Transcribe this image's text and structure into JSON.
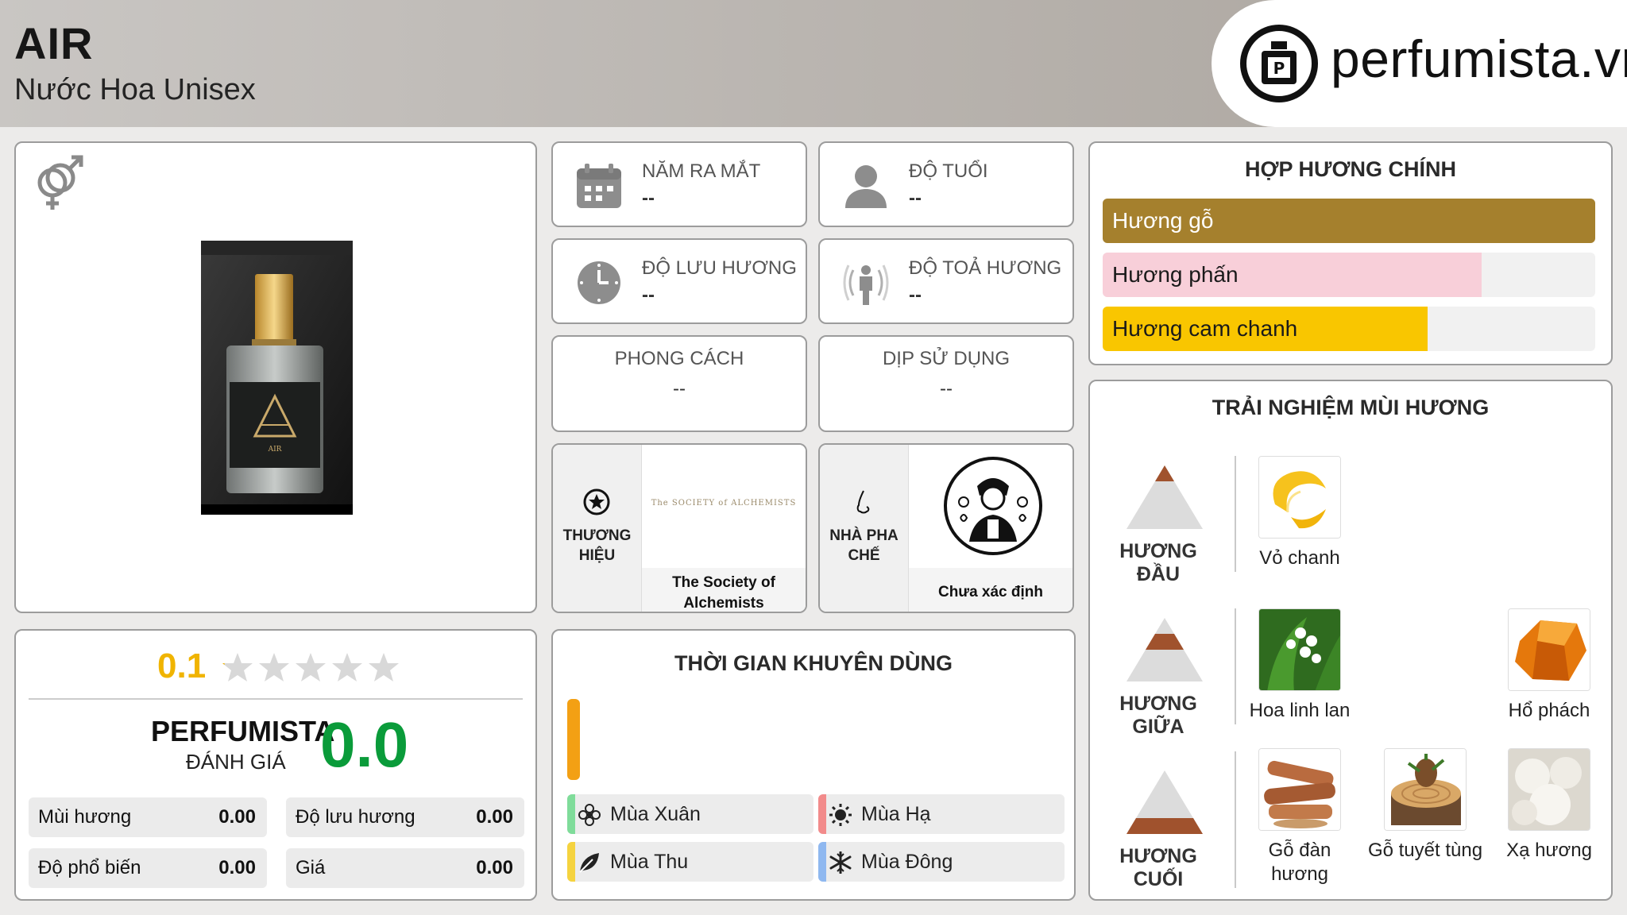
{
  "header": {
    "title": "AIR",
    "subtitle": "Nước Hoa Unisex",
    "logo_text": "perfumista.vn"
  },
  "product": {
    "gender_icon": "unisex-gender-icon",
    "bottle_label": "AIR"
  },
  "info": {
    "release_year": {
      "label": "NĂM RA MẮT",
      "value": "--",
      "icon": "calendar-icon"
    },
    "age": {
      "label": "ĐỘ TUỔI",
      "value": "--",
      "icon": "person-icon"
    },
    "longevity": {
      "label": "ĐỘ LƯU HƯƠNG",
      "value": "--",
      "icon": "clock-icon"
    },
    "sillage": {
      "label": "ĐỘ TOẢ HƯƠNG",
      "value": "--",
      "icon": "radiating-person-icon"
    },
    "style": {
      "label": "PHONG CÁCH",
      "value": "--"
    },
    "occasion": {
      "label": "DỊP SỬ DỤNG",
      "value": "--"
    }
  },
  "brand": {
    "label": "THƯƠNG HIỆU",
    "logo_text": "The SOCIETY of ALCHEMISTS",
    "name": "The Society of Alchemists",
    "icon": "star-badge-icon"
  },
  "perfumer": {
    "label": "NHÀ PHA CHẾ",
    "name": "Chưa xác định",
    "icon": "nose-icon"
  },
  "accords": {
    "title": "HỢP HƯƠNG CHÍNH",
    "items": [
      {
        "label": "Hương gỗ",
        "fraction": 1.0,
        "color": "#a5802d",
        "text_color": "#ffffff"
      },
      {
        "label": "Hương phấn",
        "fraction": 0.77,
        "color": "#f8cfd9",
        "text_color": "#1a1a1a"
      },
      {
        "label": "Hương cam chanh",
        "fraction": 0.66,
        "color": "#f9c600",
        "text_color": "#1a1a1a"
      }
    ]
  },
  "experience": {
    "title": "TRẢI NGHIỆM MÙI HƯƠNG",
    "top": {
      "label": "HƯƠNG ĐẦU",
      "notes": [
        "Vỏ chanh"
      ]
    },
    "middle": {
      "label": "HƯƠNG GIỮA",
      "notes": [
        "Hoa linh lan",
        "Hổ phách"
      ]
    },
    "base": {
      "label": "HƯƠNG CUỐI",
      "notes": [
        "Gỗ đàn hương",
        "Gỗ tuyết tùng",
        "Xạ hương"
      ]
    }
  },
  "rating": {
    "community_score": "0.1",
    "stars_filled": 0.02,
    "perfumista_label": "PERFUMISTA",
    "perfumista_sub": "ĐÁNH GIÁ",
    "perfumista_score": "0.0",
    "metrics": [
      {
        "label": "Mùi hương",
        "value": "0.00"
      },
      {
        "label": "Độ lưu hương",
        "value": "0.00"
      },
      {
        "label": "Độ phổ biến",
        "value": "0.00"
      },
      {
        "label": "Giá",
        "value": "0.00"
      }
    ]
  },
  "seasons": {
    "title": "THỜI GIAN KHUYÊN DÙNG",
    "items": [
      {
        "label": "Mùa Xuân",
        "accent": "#7fdc9a",
        "icon": "flower-icon"
      },
      {
        "label": "Mùa Hạ",
        "accent": "#f28b8b",
        "icon": "sun-icon"
      },
      {
        "label": "Mùa Thu",
        "accent": "#f5d33f",
        "icon": "leaf-icon"
      },
      {
        "label": "Mùa Đông",
        "accent": "#8fb8f0",
        "icon": "snowflake-icon"
      }
    ]
  }
}
